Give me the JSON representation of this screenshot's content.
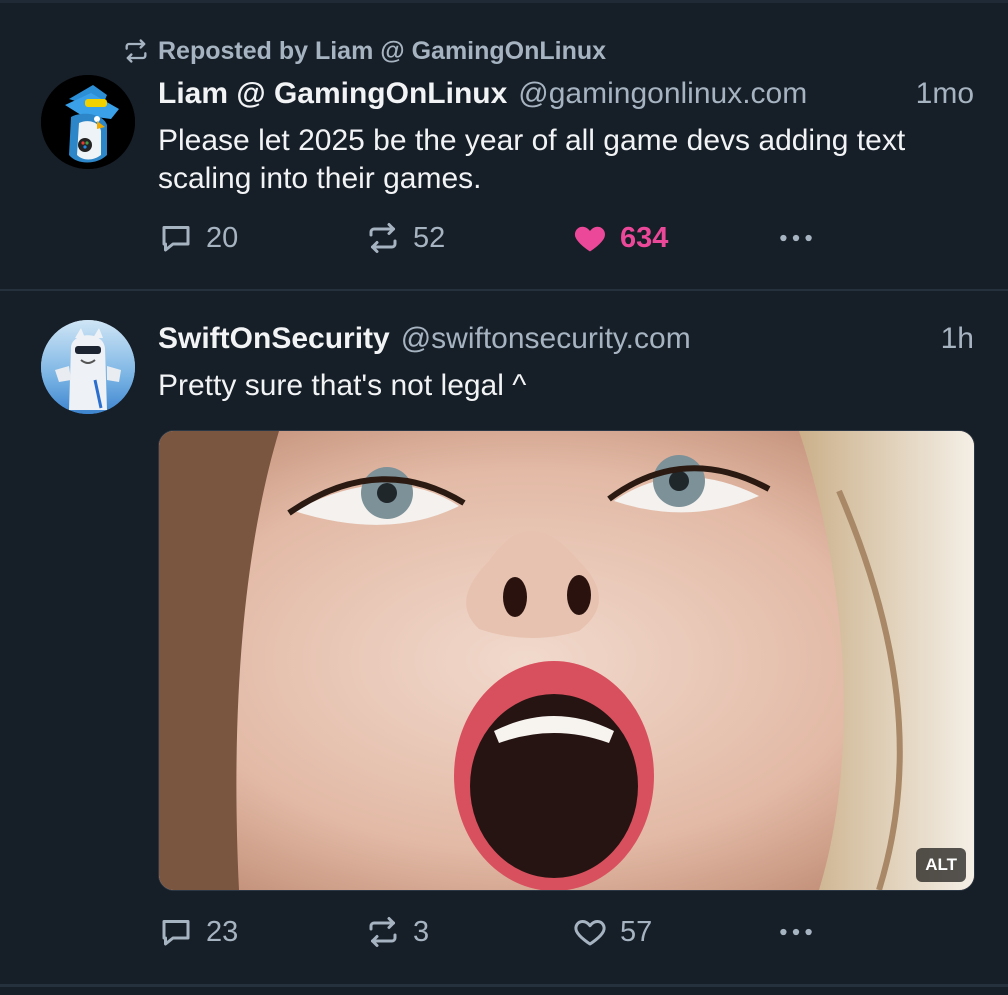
{
  "repost": {
    "label": "Reposted by Liam @ GamingOnLinux",
    "icon": "repost-icon"
  },
  "posts": [
    {
      "author_name": "Liam @ GamingOnLinux",
      "handle": "@gamingonlinux.com",
      "time": "1mo",
      "text": "Please let 2025 be the year of all game devs adding text scaling into their games.",
      "replies": "20",
      "reposts": "52",
      "likes": "634",
      "liked": true,
      "avatar": "penguin-avatar"
    },
    {
      "author_name": "SwiftOnSecurity",
      "handle": "@swiftonsecurity.com",
      "time": "1h",
      "text": "Pretty sure that's not legal ^",
      "replies": "23",
      "reposts": "3",
      "likes": "57",
      "liked": false,
      "avatar": "mascot-avatar",
      "media_alt_label": "ALT"
    }
  ],
  "colors": {
    "background": "#161e27",
    "text_primary": "#f1f3f5",
    "text_secondary": "#a6b3c1",
    "like_active": "#ec4899",
    "divider": "#25313d"
  }
}
